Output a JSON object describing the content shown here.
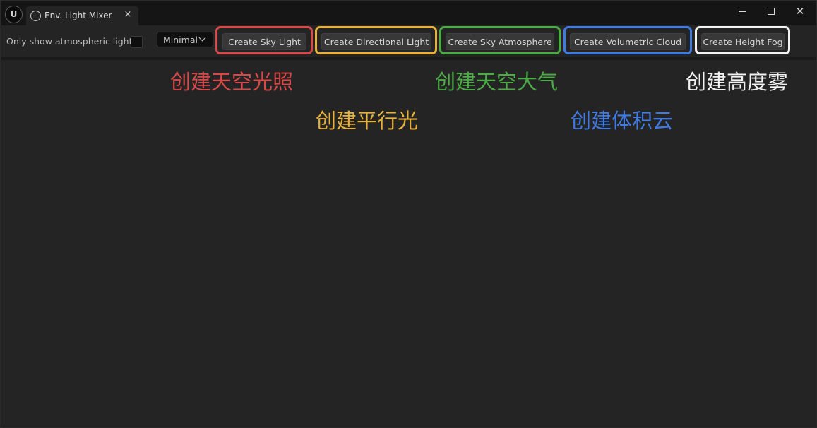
{
  "window": {
    "logo": "U",
    "tab_title": "Env. Light Mixer",
    "tab_close": "×",
    "close_glyph": "✕"
  },
  "toolbar": {
    "checkbox_label": "Only show atmospheric lights",
    "checkbox_checked": false,
    "mode_value": "Minimal",
    "buttons": [
      {
        "label": "Create Sky Light",
        "highlight_color": "#d84a4a"
      },
      {
        "label": "Create Directional Light",
        "highlight_color": "#e8b23a"
      },
      {
        "label": "Create Sky Atmosphere",
        "highlight_color": "#4bab45"
      },
      {
        "label": "Create Volumetric Cloud",
        "highlight_color": "#3f7be3"
      },
      {
        "label": "Create Height Fog",
        "highlight_color": "#f2f2f2"
      }
    ]
  },
  "annotations": [
    {
      "text": "创建天空光照",
      "color": "#d84a4a"
    },
    {
      "text": "创建平行光",
      "color": "#e8b23a"
    },
    {
      "text": "创建天空大气",
      "color": "#4bab45"
    },
    {
      "text": "创建体积云",
      "color": "#3f7be3"
    },
    {
      "text": "创建高度雾",
      "color": "#f2f2f2"
    }
  ],
  "icons": {
    "app": "unreal-logo-icon",
    "tab": "light-mixer-icon",
    "combo": "chevron-down-icon"
  }
}
